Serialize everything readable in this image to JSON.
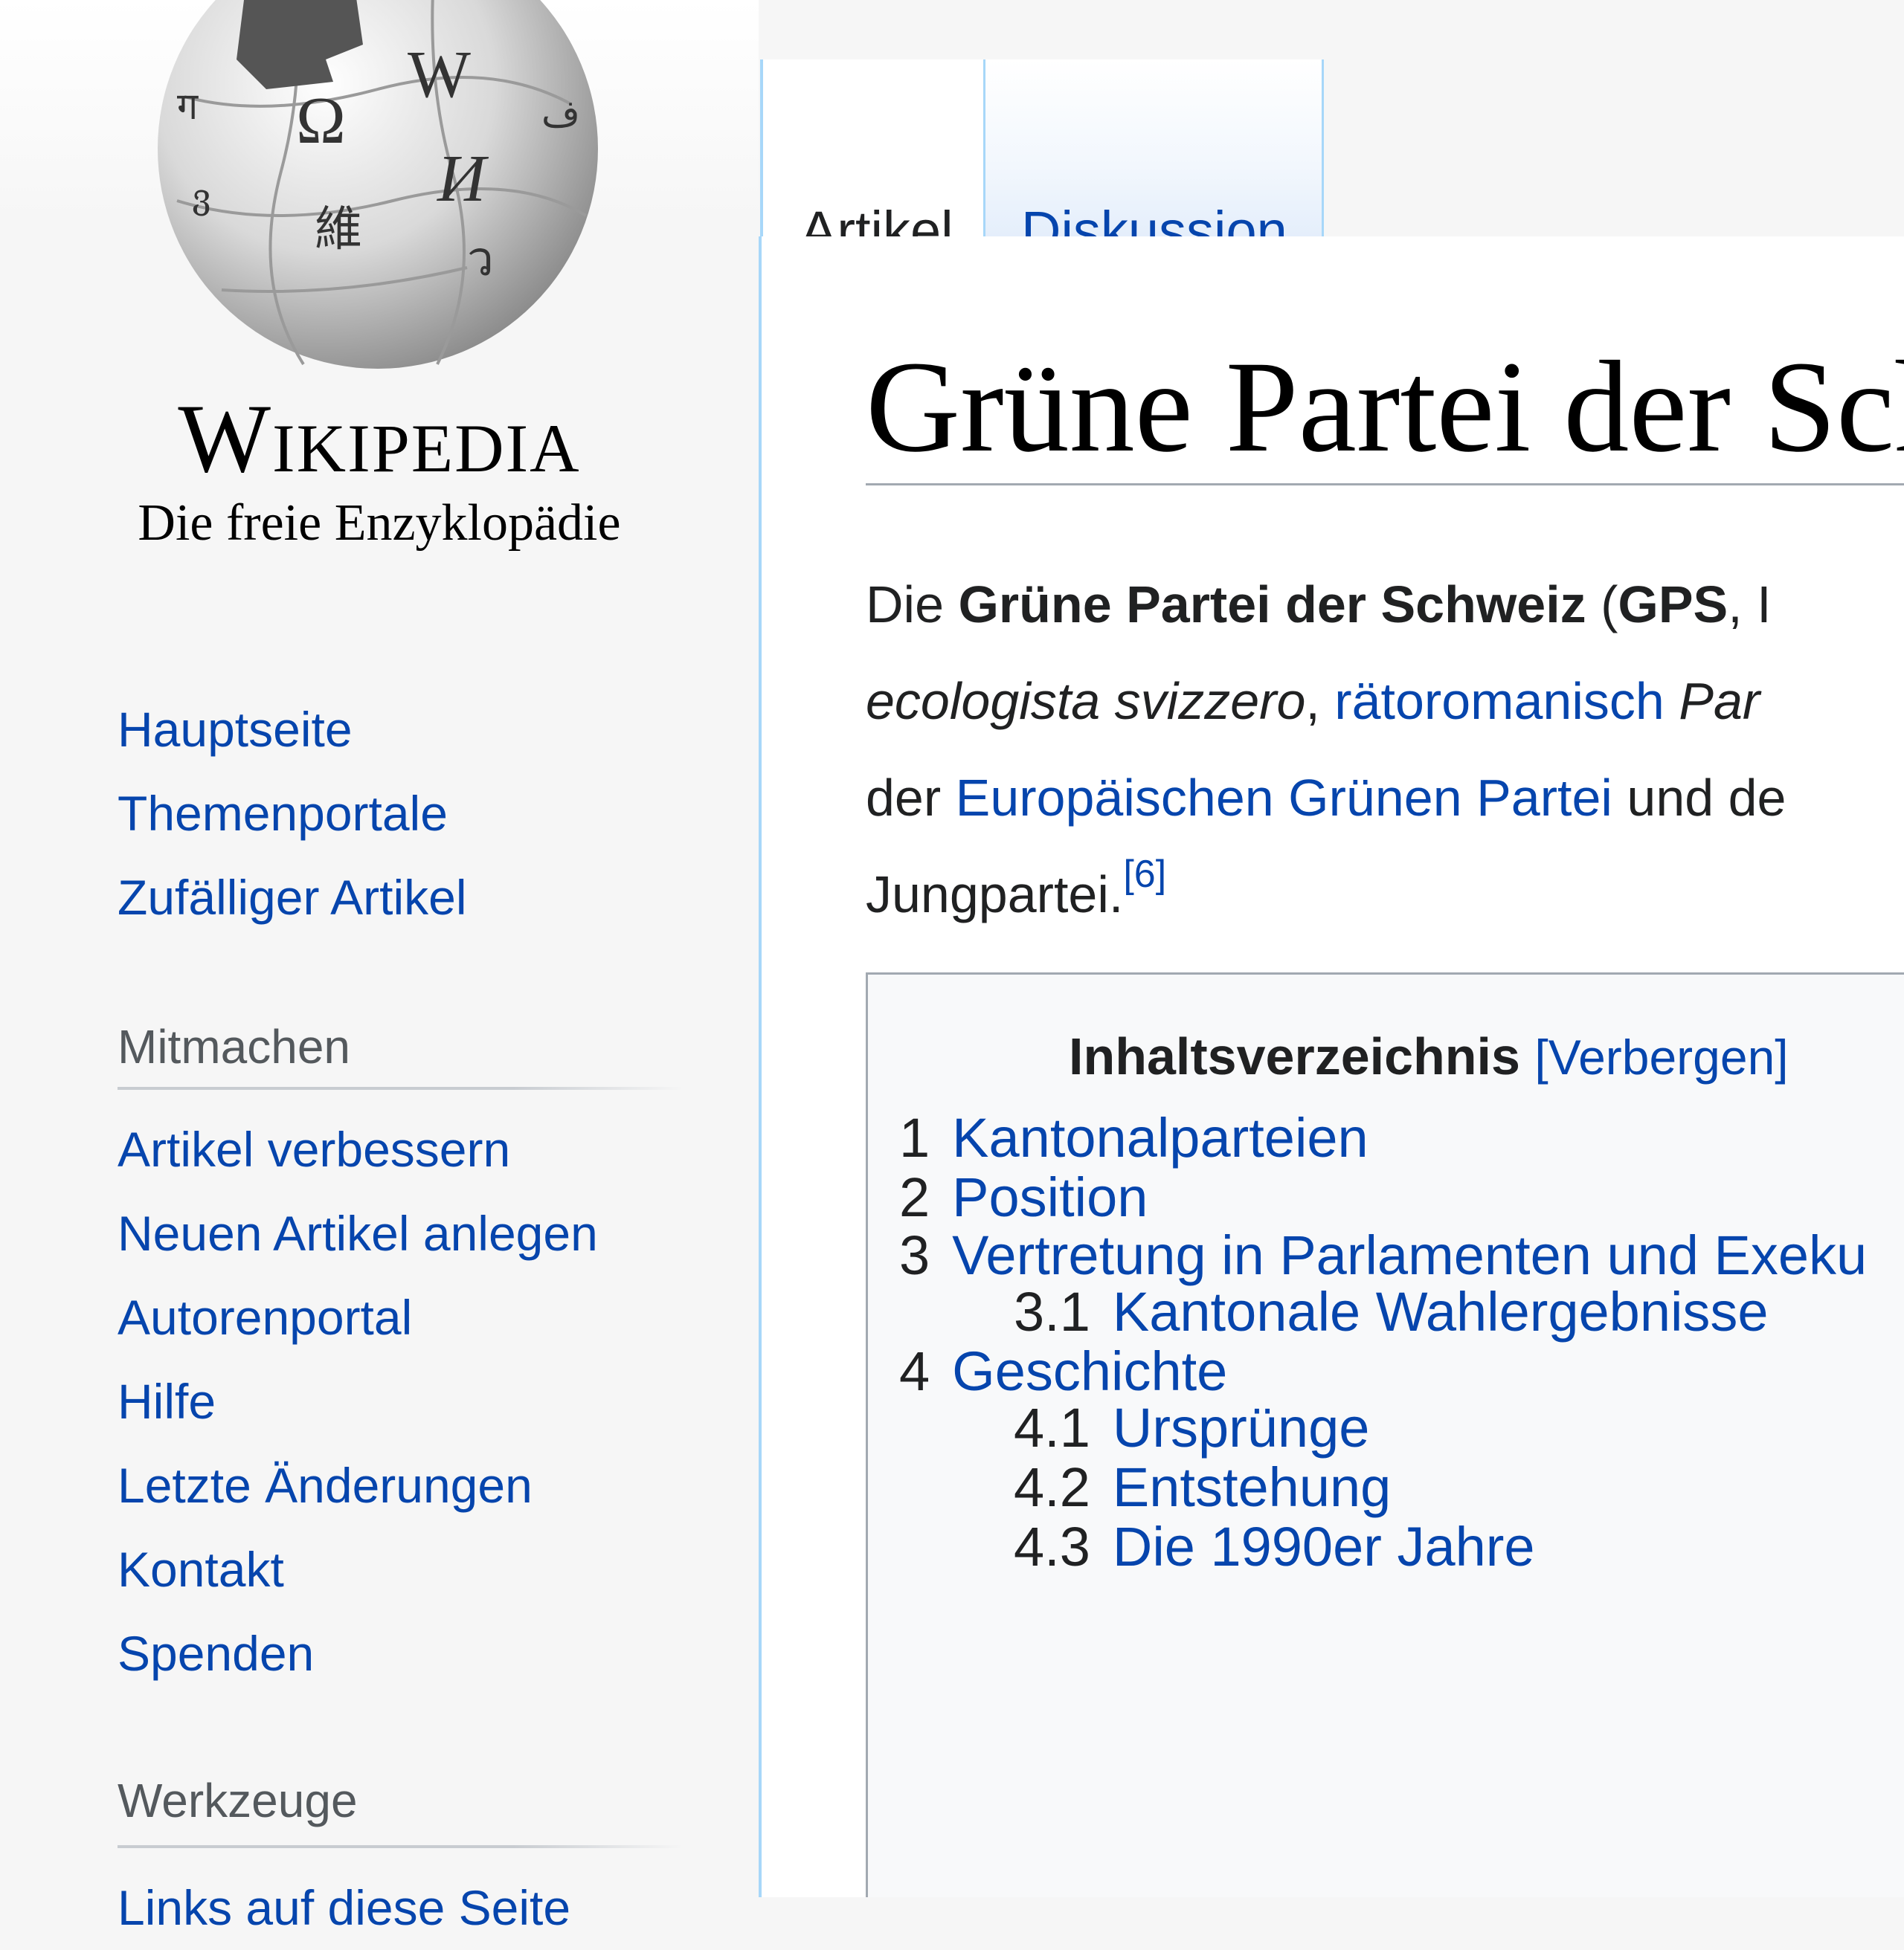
{
  "logo": {
    "wordmark": "Wikipedia",
    "tagline": "Die freie Enzyklopädie"
  },
  "sidebar": {
    "main_nav": [
      "Hauptseite",
      "Themenportale",
      "Zufälliger Artikel"
    ],
    "mitmachen": {
      "heading": "Mitmachen",
      "items": [
        "Artikel verbessern",
        "Neuen Artikel anlegen",
        "Autorenportal",
        "Hilfe",
        "Letzte Änderungen",
        "Kontakt",
        "Spenden"
      ]
    },
    "werkzeuge": {
      "heading": "Werkzeuge",
      "first_item": "Links auf diese Seite"
    }
  },
  "tabs": {
    "artikel": "Artikel",
    "diskussion": "Diskussion"
  },
  "article": {
    "title": "Grüne Partei der Schweiz",
    "intro": {
      "l1_a": "Die ",
      "l1_b": "Grüne Partei der Schweiz",
      "l1_c": " (",
      "l1_d": "GPS",
      "l1_e": ", I",
      "l2_a": "ecologista svizzero",
      "l2_b": ", ",
      "l2_c": "rätoromanisch",
      "l2_d": " Par",
      "l3_a": "der ",
      "l3_b": "Europäischen Grünen Partei",
      "l3_c": " und de",
      "l4_a": "Jungpartei.",
      "l4_ref": "[6]"
    }
  },
  "toc": {
    "title": "Inhaltsverzeichnis",
    "toggle": "[Verbergen]",
    "items": [
      {
        "num": "1",
        "label": "Kantonalparteien"
      },
      {
        "num": "2",
        "label": "Position"
      },
      {
        "num": "3",
        "label": "Vertretung in Parlamenten und Exeku"
      },
      {
        "num": "3.1",
        "label": "Kantonale Wahlergebnisse"
      },
      {
        "num": "4",
        "label": "Geschichte"
      },
      {
        "num": "4.1",
        "label": "Ursprünge"
      },
      {
        "num": "4.2",
        "label": "Entstehung"
      },
      {
        "num": "4.3",
        "label": "Die 1990er Jahre"
      }
    ]
  },
  "colors": {
    "link": "#0645ad",
    "text": "#202122",
    "tab_border": "#a7d7f9",
    "sidebar_bg": "#f6f6f6",
    "toc_bg": "#f8f9fa"
  }
}
